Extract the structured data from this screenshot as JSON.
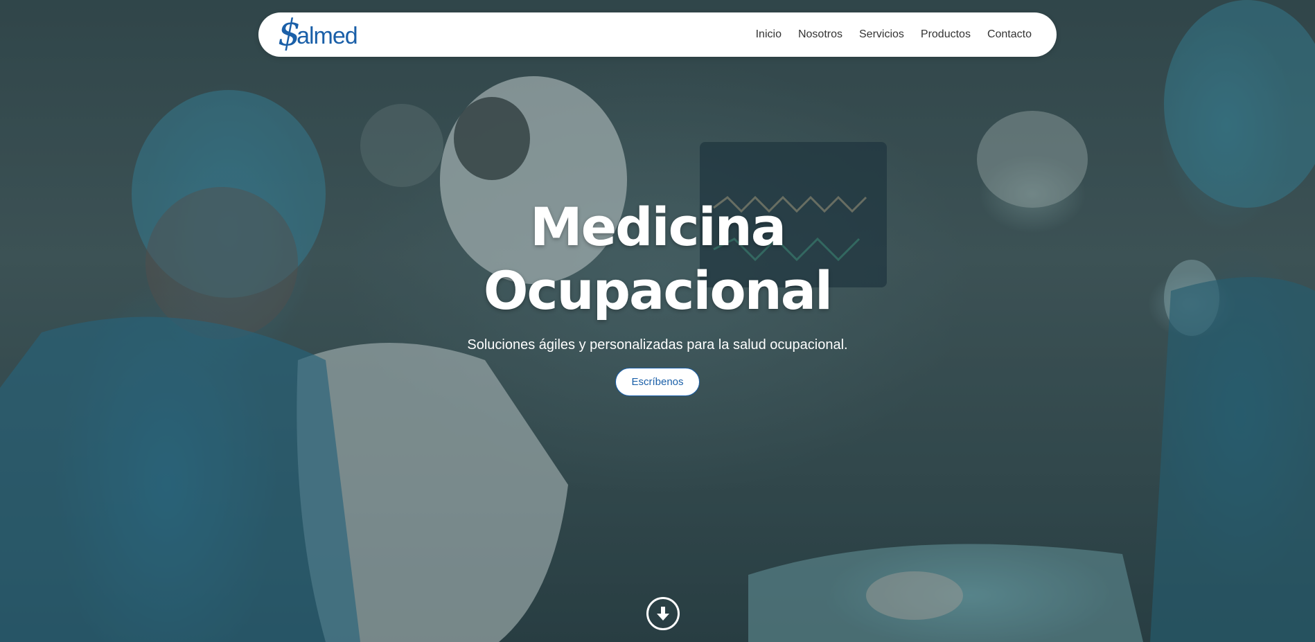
{
  "brand": {
    "logo_mark": "$",
    "logo_text": "almed",
    "color": "#1a5fa8"
  },
  "nav": {
    "items": [
      {
        "label": "Inicio"
      },
      {
        "label": "Nosotros"
      },
      {
        "label": "Servicios"
      },
      {
        "label": "Productos"
      },
      {
        "label": "Contacto"
      }
    ]
  },
  "hero": {
    "title_line1": "Medicina",
    "title_line2": "Ocupacional",
    "subtitle": "Soluciones ágiles y personalizadas para la salud ocupacional.",
    "cta_label": "Escríbenos"
  },
  "icons": {
    "scroll": "arrow-down-circle-icon"
  }
}
